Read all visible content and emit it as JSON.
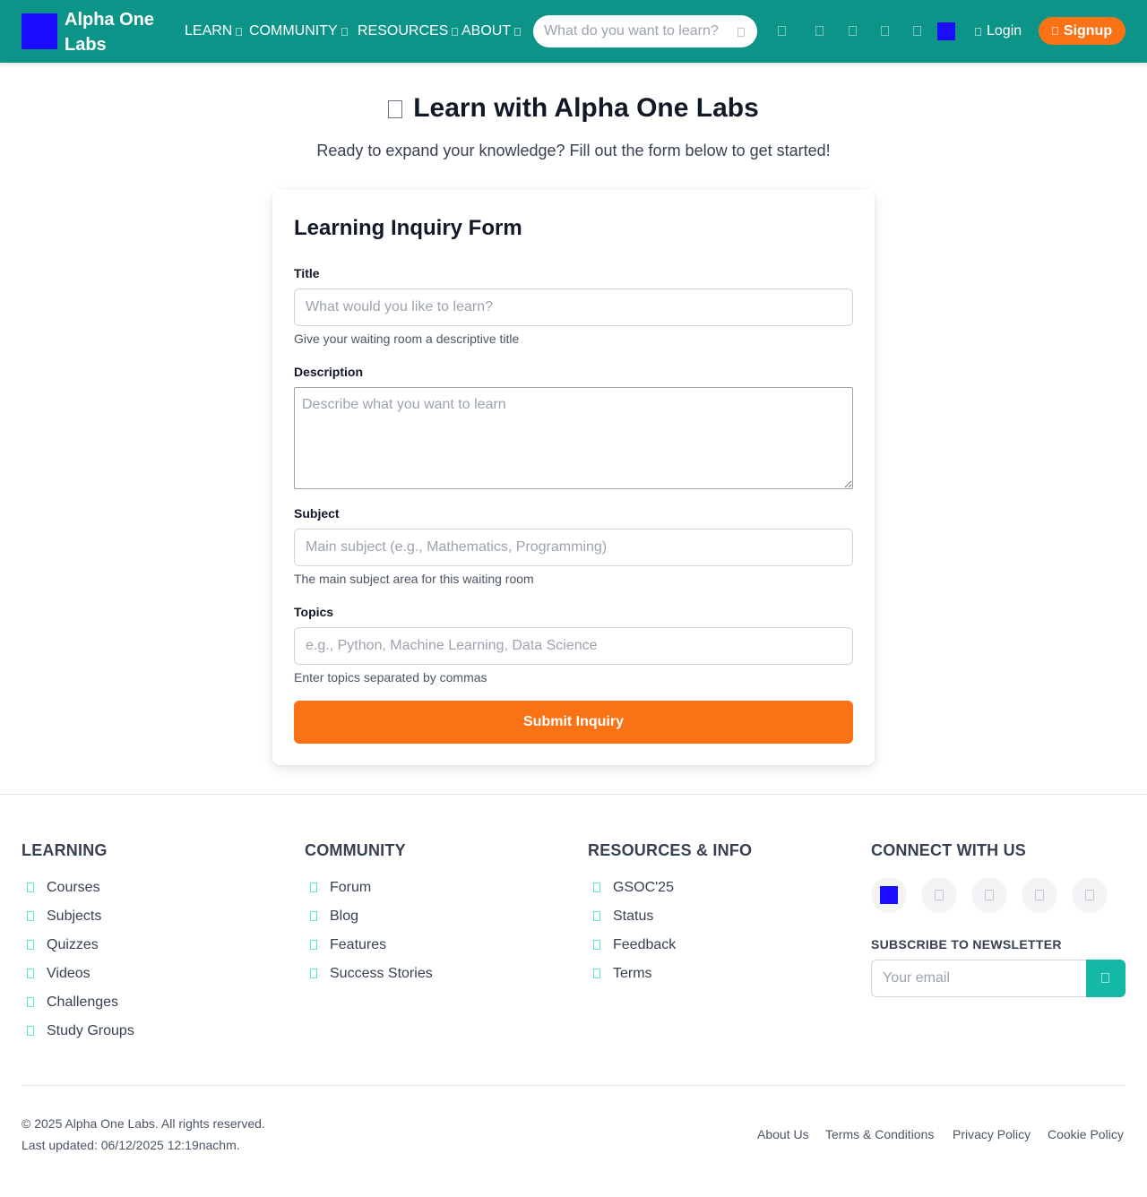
{
  "header": {
    "brand": "Alpha One Labs",
    "nav": [
      {
        "label": "LEARN",
        "icon": "chevron-down-icon"
      },
      {
        "label": "COMMUNITY",
        "icon": "chevron-down-icon"
      },
      {
        "label": "RESOURCES",
        "icon": "chevron-down-icon"
      },
      {
        "label": "ABOUT",
        "icon": "chevron-down-icon"
      }
    ],
    "search_placeholder": "What do you want to learn?",
    "login_label": "Login",
    "signup_label": "Signup"
  },
  "hero": {
    "title": "Learn with Alpha One Labs",
    "subtitle": "Ready to expand your knowledge? Fill out the form below to get started!"
  },
  "form": {
    "title": "Learning Inquiry Form",
    "fields": {
      "title": {
        "label": "Title",
        "placeholder": "What would you like to learn?",
        "help": "Give your waiting room a descriptive title"
      },
      "description": {
        "label": "Description",
        "placeholder": "Describe what you want to learn"
      },
      "subject": {
        "label": "Subject",
        "placeholder": "Main subject (e.g., Mathematics, Programming)",
        "help": "The main subject area for this waiting room"
      },
      "topics": {
        "label": "Topics",
        "placeholder": "e.g., Python, Machine Learning, Data Science",
        "help": "Enter topics separated by commas"
      }
    },
    "submit_label": "Submit Inquiry"
  },
  "footer": {
    "learning": {
      "heading": "LEARNING",
      "links": [
        "Courses",
        "Subjects",
        "Quizzes",
        "Videos",
        "Challenges",
        "Study Groups"
      ]
    },
    "community": {
      "heading": "COMMUNITY",
      "links": [
        "Forum",
        "Blog",
        "Features",
        "Success Stories"
      ]
    },
    "resources": {
      "heading": "RESOURCES & INFO",
      "links": [
        "GSOC'25",
        "Status",
        "Feedback",
        "Terms"
      ]
    },
    "connect": {
      "heading": "CONNECT WITH US",
      "newsletter_label": "SUBSCRIBE TO NEWSLETTER",
      "email_placeholder": "Your email"
    },
    "copyright": "© 2025 Alpha One Labs. All rights reserved.",
    "last_updated": "Last updated: 06/12/2025 12:19nachm.",
    "bottom_links": [
      "About Us",
      "Terms & Conditions",
      "Privacy Policy",
      "Cookie Policy"
    ]
  },
  "colors": {
    "header_bg": "#0d9488",
    "accent_orange": "#f97316",
    "teal_button": "#14b8a6",
    "logo_blue": "#1a0dff"
  }
}
